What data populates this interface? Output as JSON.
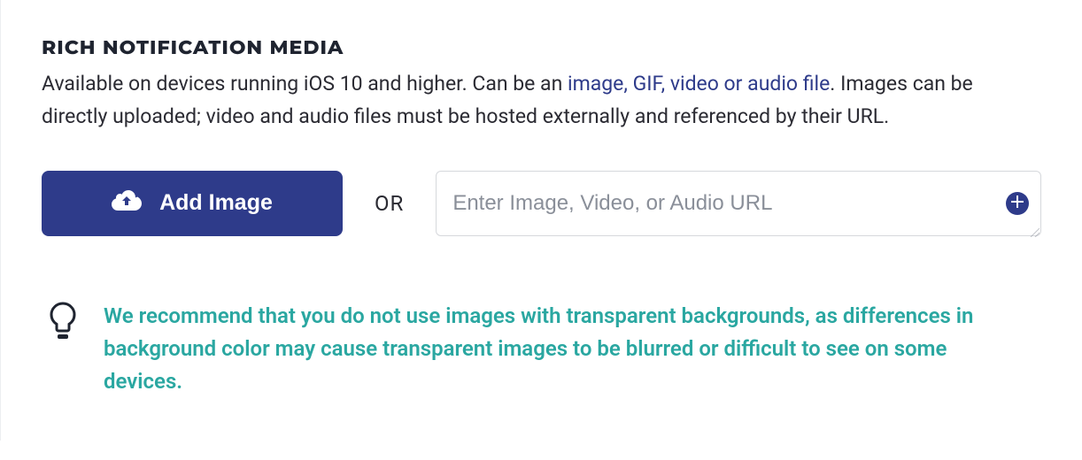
{
  "section": {
    "heading": "RICH NOTIFICATION MEDIA",
    "description_prefix": "Available on devices running iOS 10 and higher. Can be an ",
    "description_link": "image, GIF, video or audio file",
    "description_suffix": ". Images can be directly uploaded; video and audio files must be hosted externally and referenced by their URL."
  },
  "controls": {
    "add_image_label": "Add Image",
    "or_label": "OR",
    "url_placeholder": "Enter Image, Video, or Audio URL",
    "url_value": ""
  },
  "tip": {
    "text": "We recommend that you do not use images with transparent backgrounds, as differences in background color may cause transparent images to be blurred or difficult to see on some devices."
  },
  "colors": {
    "accent": "#2e3b8a",
    "tip": "#2aa7a1"
  }
}
